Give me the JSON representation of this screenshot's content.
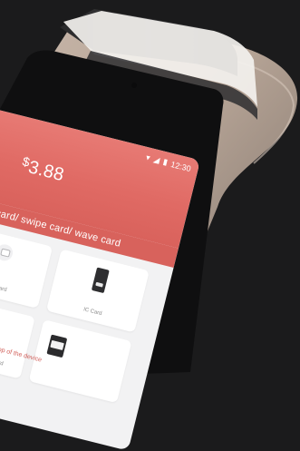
{
  "screen": {
    "status_time": "12:30",
    "amount": "3.88",
    "currency_symbol": "$",
    "instruction": "Insert card/ swipe card/ wave card",
    "tiles": [
      {
        "label": "Tap Card"
      },
      {
        "label": "IC Card"
      },
      {
        "label": "Magnetic Stripe Card"
      },
      {
        "label": ""
      }
    ],
    "tip": "Tap the card on the top of the device"
  },
  "colors": {
    "background": "#1b1b1c",
    "header_red": "#e06a64",
    "device_body": "#b8a79a"
  },
  "icons": [
    "back-chevron-icon",
    "wifi-icon",
    "signal-icon",
    "battery-icon",
    "contactless-tap-icon",
    "card-reader-icon",
    "magnetic-stripe-icon"
  ]
}
